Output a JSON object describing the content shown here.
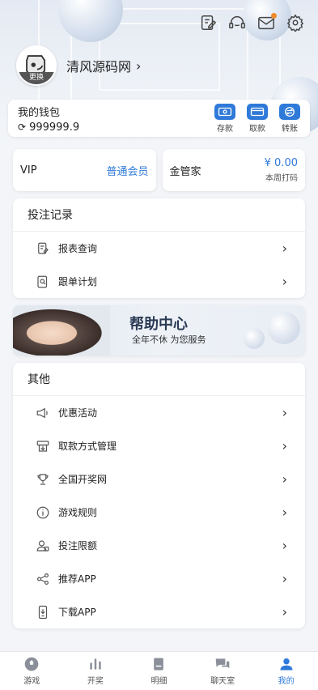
{
  "header": {
    "username": "清风源码网",
    "avatar_badge": "更换",
    "icons": [
      "edit-icon",
      "headset-icon",
      "mail-icon",
      "gear-icon"
    ]
  },
  "wallet": {
    "title": "我的钱包",
    "amount": "999999.9",
    "actions": [
      {
        "label": "存款",
        "icon": "deposit-icon"
      },
      {
        "label": "取款",
        "icon": "withdraw-icon"
      },
      {
        "label": "转账",
        "icon": "transfer-icon"
      }
    ]
  },
  "vip": {
    "label": "VIP",
    "value": "普通会员"
  },
  "manager": {
    "label": "金管家",
    "amount": "¥ 0.00",
    "note": "本周打码"
  },
  "bet_section": {
    "title": "投注记录",
    "items": [
      {
        "label": "报表查询",
        "icon": "report-icon"
      },
      {
        "label": "跟单计划",
        "icon": "search-doc-icon"
      }
    ]
  },
  "help": {
    "title": "帮助中心",
    "subtitle": "全年不休 为您服务"
  },
  "other_section": {
    "title": "其他",
    "items": [
      {
        "label": "优惠活动",
        "icon": "megaphone-icon"
      },
      {
        "label": "取款方式管理",
        "icon": "withdraw-method-icon"
      },
      {
        "label": "全国开奖网",
        "icon": "trophy-icon"
      },
      {
        "label": "游戏规则",
        "icon": "info-icon"
      },
      {
        "label": "投注限额",
        "icon": "user-limit-icon"
      },
      {
        "label": "推荐APP",
        "icon": "share-icon"
      },
      {
        "label": "下载APP",
        "icon": "download-phone-icon"
      }
    ]
  },
  "tabbar": {
    "active": "我的",
    "tabs": [
      {
        "label": "游戏",
        "icon": "ball-icon"
      },
      {
        "label": "开奖",
        "icon": "chart-icon"
      },
      {
        "label": "明细",
        "icon": "list-icon"
      },
      {
        "label": "聊天室",
        "icon": "chat-icon"
      },
      {
        "label": "我的",
        "icon": "profile-icon"
      }
    ]
  },
  "colors": {
    "accent": "#2f7ad9",
    "notice_dot": "#f08a2a"
  }
}
